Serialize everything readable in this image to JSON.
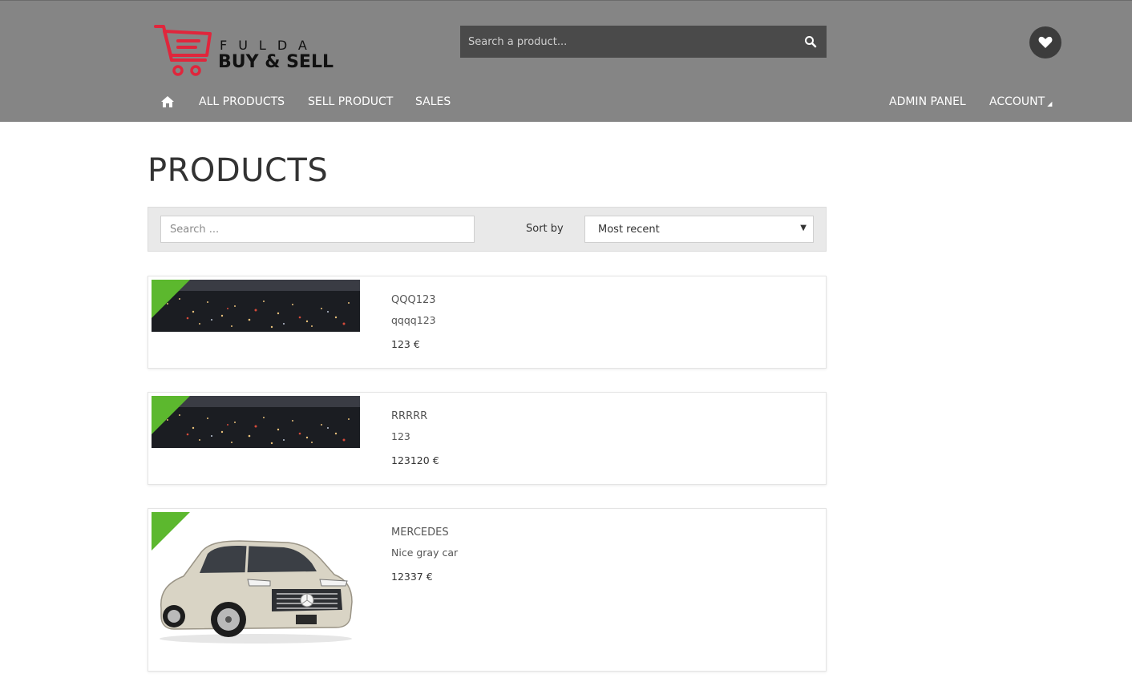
{
  "brand": {
    "line1": "FULDA",
    "line2": "BUY & SELL",
    "accent": "#e0263c"
  },
  "header": {
    "search_placeholder": "Search a product...",
    "nav": {
      "all_products": "ALL PRODUCTS",
      "sell_product": "SELL PRODUCT",
      "sales": "SALES",
      "admin_panel": "ADMIN PANEL",
      "account": "ACCOUNT"
    }
  },
  "main": {
    "title": "PRODUCTS",
    "filter": {
      "search_placeholder": "Search ...",
      "sort_label": "Sort by",
      "sort_value": "Most recent"
    },
    "products": [
      {
        "name": "QQQ123",
        "description": "qqqq123",
        "price": "123 €",
        "image": "city-night"
      },
      {
        "name": "RRRRR",
        "description": "123",
        "price": "123120 €",
        "image": "city-night"
      },
      {
        "name": "MERCEDES",
        "description": "Nice gray car",
        "price": "12337 €",
        "image": "car"
      }
    ]
  },
  "colors": {
    "header_bg": "#858585",
    "search_bg": "#4a4a4a",
    "badge_green": "#5cb82e"
  }
}
